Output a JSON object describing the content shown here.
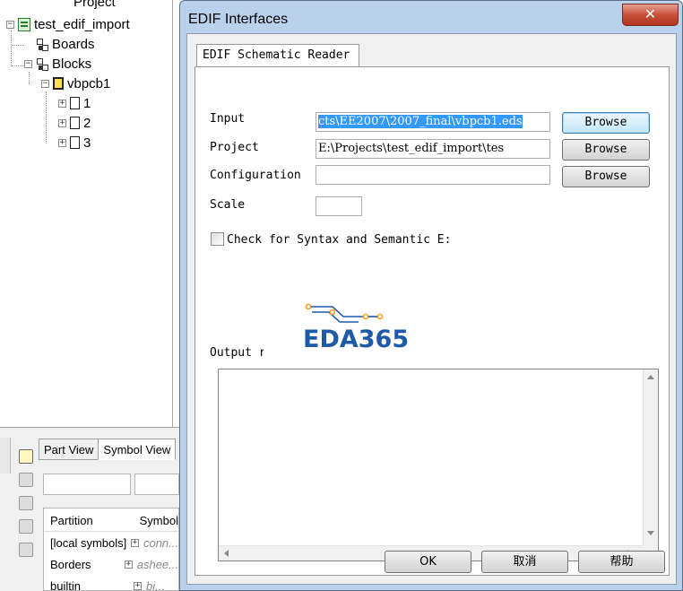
{
  "project_tree": {
    "caption": "Project",
    "root": "test_edif_import",
    "boards": "Boards",
    "blocks": "Blocks",
    "block_name": "vbpcb1",
    "pages": [
      "1",
      "2",
      "3"
    ]
  },
  "bottom_panel": {
    "tabs": [
      "Part View",
      "Symbol View"
    ],
    "grid_headers": [
      "Partition",
      "Symbol"
    ],
    "grid_rows": [
      {
        "partition": "[local symbols]",
        "symbol": "conn..."
      },
      {
        "partition": "Borders",
        "symbol": "ashee..."
      },
      {
        "partition": "builtin",
        "symbol": "bi..."
      }
    ]
  },
  "dialog": {
    "title": "EDIF Interfaces",
    "close_glyph": "✕",
    "tab_label": "EDIF Schematic Reader",
    "input_label": "Input",
    "input_value": "cts\\EE2007\\2007_final\\vbpcb1.eds",
    "project_label": "Project",
    "project_value": "E:\\Projects\\test_edif_import\\tes",
    "config_label": "Configuration file",
    "config_value": "",
    "scale_label": "Scale",
    "scale_value": "",
    "browse_label": "Browse",
    "check_label": "Check for Syntax and Semantic E:",
    "check_checked": false,
    "output_label": "Output results",
    "output_text": "",
    "watermark": "EDA365",
    "ok_label": "OK",
    "cancel_label": "取消",
    "help_label": "帮助"
  },
  "colors": {
    "dialog_frame": "#b9d1ea",
    "selection": "#3399ff",
    "logo_blue": "#1f5aa8",
    "logo_orange": "#f0a020"
  }
}
